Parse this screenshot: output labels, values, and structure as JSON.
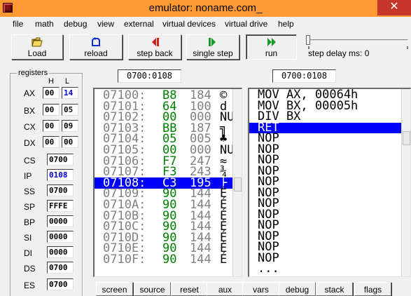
{
  "window": {
    "title": "emulator: noname.com_",
    "close_glyph": "✕"
  },
  "menu": [
    "file",
    "math",
    "debug",
    "view",
    "external",
    "virtual devices",
    "virtual drive",
    "help"
  ],
  "toolbar": {
    "load": "Load",
    "reload": "reload",
    "step_back": "step back",
    "single_step": "single step",
    "run": "run",
    "step_delay": "step delay ms: 0"
  },
  "registers": {
    "title": "registers",
    "h_label": "H",
    "l_label": "L",
    "split": [
      {
        "name": "AX",
        "h": "00",
        "l": "14"
      },
      {
        "name": "BX",
        "h": "00",
        "l": "05"
      },
      {
        "name": "CX",
        "h": "00",
        "l": "09"
      },
      {
        "name": "DX",
        "h": "00",
        "l": "00"
      }
    ],
    "full": [
      {
        "name": "CS",
        "value": "0700"
      },
      {
        "name": "IP",
        "value": "0108"
      },
      {
        "name": "SS",
        "value": "0700"
      },
      {
        "name": "SP",
        "value": "FFFE"
      },
      {
        "name": "BP",
        "value": "0000"
      },
      {
        "name": "SI",
        "value": "0000"
      },
      {
        "name": "DI",
        "value": "0000"
      },
      {
        "name": "DS",
        "value": "0700"
      },
      {
        "name": "ES",
        "value": "0700"
      }
    ]
  },
  "memory": {
    "address": "0700:0108",
    "rows": [
      {
        "addr": "07100:",
        "hex": "B8",
        "dec": "184",
        "chr": "©"
      },
      {
        "addr": "07101:",
        "hex": "64",
        "dec": "100",
        "chr": "d"
      },
      {
        "addr": "07102:",
        "hex": "00",
        "dec": "000",
        "chr": "NU"
      },
      {
        "addr": "07103:",
        "hex": "BB",
        "dec": "187",
        "chr": "╗"
      },
      {
        "addr": "07104:",
        "hex": "05",
        "dec": "005",
        "chr": "♣"
      },
      {
        "addr": "07105:",
        "hex": "00",
        "dec": "000",
        "chr": "NU"
      },
      {
        "addr": "07106:",
        "hex": "F7",
        "dec": "247",
        "chr": "≈"
      },
      {
        "addr": "07107:",
        "hex": "F3",
        "dec": "243",
        "chr": "¾"
      },
      {
        "addr": "07108:",
        "hex": "C3",
        "dec": "195",
        "chr": "├"
      },
      {
        "addr": "07109:",
        "hex": "90",
        "dec": "144",
        "chr": "É"
      },
      {
        "addr": "0710A:",
        "hex": "90",
        "dec": "144",
        "chr": "É"
      },
      {
        "addr": "0710B:",
        "hex": "90",
        "dec": "144",
        "chr": "É"
      },
      {
        "addr": "0710C:",
        "hex": "90",
        "dec": "144",
        "chr": "É"
      },
      {
        "addr": "0710D:",
        "hex": "90",
        "dec": "144",
        "chr": "É"
      },
      {
        "addr": "0710E:",
        "hex": "90",
        "dec": "144",
        "chr": "É"
      },
      {
        "addr": "0710F:",
        "hex": "90",
        "dec": "144",
        "chr": "É"
      }
    ]
  },
  "disassembly": {
    "address": "0700:0108",
    "lines": [
      "MOV AX, 00064h",
      "MOV BX, 00005h",
      "DIV BX",
      "RET",
      "NOP",
      "NOP",
      "NOP",
      "NOP",
      "NOP",
      "NOP",
      "NOP",
      "NOP",
      "NOP",
      "NOP",
      "NOP",
      "NOP",
      "..."
    ]
  },
  "bottom_buttons": [
    "screen",
    "source",
    "reset",
    "aux",
    "vars",
    "debug",
    "stack",
    "flags"
  ],
  "colors": {
    "title_bar": "#ff9933",
    "selection": "#0000ff",
    "hex_green": "#008000",
    "close": "#c7362a"
  }
}
